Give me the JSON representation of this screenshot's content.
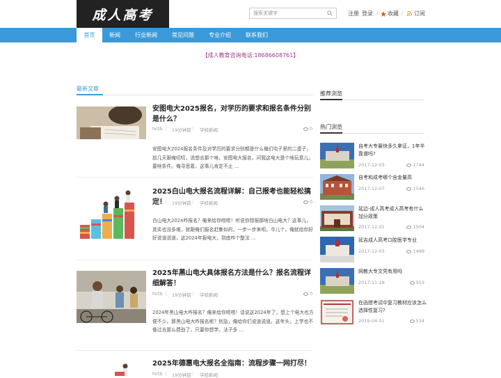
{
  "header": {
    "logo_text": "成人高考",
    "search_placeholder": "搜索关键字",
    "register": "注册",
    "login": "登录",
    "favorite": "收藏",
    "subscribe": "订阅"
  },
  "nav": [
    "首页",
    "新闻",
    "行业新闻",
    "常见问题",
    "专业介绍",
    "联系我们"
  ],
  "notice": "【成人教育咨询电话:18686608761】",
  "main": {
    "section_title": "最新文章",
    "posts": [
      {
        "title": "安图电大2025报名，对学历的要求和报名条件分别是什么？",
        "author": "hctb",
        "time": "19分钟前",
        "category": "学校新闻",
        "views": "0",
        "excerpt": "安图电大2024报名条件及对学历的要求分别都是什么俺们屯子里的二蛋子，前几天跟俺叨叨，说想去那个啥，安图电大报名，问我这电大是个啥玩意儿，要啥条件。俺寻思着，这事儿肯定不止 ..."
      },
      {
        "title": "2025白山电大报名流程详解：自己报考也能轻松搞定！",
        "author": "hctb",
        "time": "19分钟前",
        "category": "学校新闻",
        "views": "0",
        "excerpt": "白山电大2024咋报名？俺来给你唠唠！听说你想报那啥白山电大？这事儿，其实也没多难，就跟俺们报名赶集似的，一步一步来呗。今儿个，俺就给你好好说道说道，这2024年报电大，到底咋个整法 ..."
      },
      {
        "title": "2025年黑山电大具体报名方法是什么？报名流程详细解答！",
        "author": "hctb",
        "time": "19分钟前",
        "category": "学校新闻",
        "views": "0",
        "excerpt": "2024年黑山电大咋报名？俺来给你唠唠！话说这2024年了，想上个电大也方便不少。那黑山电大咋报名呢？别急，俺给你们说道说道。这年头，上学也不像过去那么费劲了，只要你想学，法子多 ..."
      },
      {
        "title": "2025年德惠电大报名全指南：流程步骤一网打尽！",
        "author": "hctb",
        "time": "19分钟前",
        "category": "学校新闻",
        "views": "0",
        "excerpt": ""
      }
    ]
  },
  "sidebar": {
    "recommend_title": "推荐浏览",
    "hot_title": "热门浏览",
    "items": [
      {
        "title": "自考大专最快多久拿证，1年半靠谱吗?",
        "date": "2017-12-03",
        "views": "1744"
      },
      {
        "title": "自考和成考哪个含金量高",
        "date": "2017-12-07",
        "views": "1546"
      },
      {
        "title": "延边-成人高考成人高考有什么加分政策",
        "date": "2017-12-01",
        "views": "1504"
      },
      {
        "title": "延吉成人高考口腔医学专业",
        "date": "2017-12-03",
        "views": "1499"
      },
      {
        "title": "网教大专文凭有用吗",
        "date": "2017-11-28",
        "views": "553"
      },
      {
        "title": "在函授考试中复习教材应该怎么选择性复习?",
        "date": "2019-04-01",
        "views": "534"
      }
    ]
  },
  "colors": {
    "accent": "#3a9ad9",
    "notice": "#a0378c",
    "logo_bg": "#222222"
  }
}
